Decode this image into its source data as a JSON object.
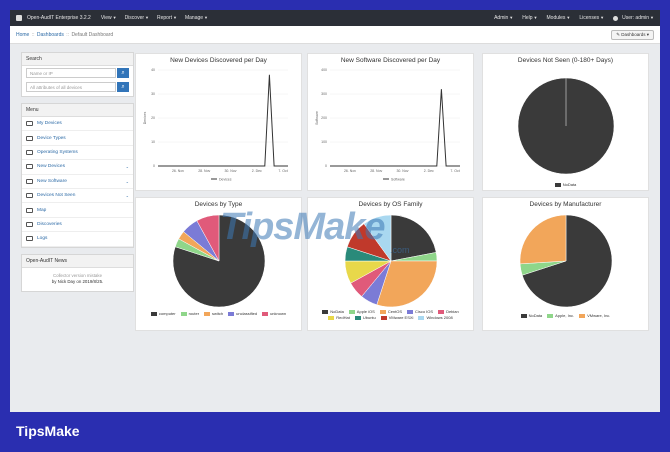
{
  "navbar": {
    "brand": "Open-AudIT Enterprise 3.2.2",
    "left_items": [
      "View",
      "Discover",
      "Report",
      "Manage"
    ],
    "right_items": [
      "Admin",
      "Help",
      "Modules",
      "Licenses"
    ],
    "user": "User: admin"
  },
  "breadcrumb": {
    "home": "Home",
    "dashboards": "Dashboards",
    "current": "Default Dashboard"
  },
  "dashboards_button": "Dashboards",
  "search": {
    "title": "Search",
    "ip_placeholder": "Name or IP",
    "attr_placeholder": "All attributes of all devices"
  },
  "menu": {
    "title": "Menu",
    "items": [
      {
        "label": "My Devices",
        "icon": "monitor-icon",
        "chevron": ""
      },
      {
        "label": "Device Types",
        "icon": "laptop-icon",
        "chevron": ""
      },
      {
        "label": "Operating Systems",
        "icon": "tag-icon",
        "chevron": ""
      },
      {
        "label": "New Devices",
        "icon": "monitor-icon",
        "chevron": "⌄"
      },
      {
        "label": "New Software",
        "icon": "chart-icon",
        "chevron": "⌄"
      },
      {
        "label": "Devices Not Seen",
        "icon": "server-icon",
        "chevron": "⌄"
      },
      {
        "label": "Map",
        "icon": "map-icon",
        "chevron": ""
      },
      {
        "label": "Discoveries",
        "icon": "globe-icon",
        "chevron": ""
      },
      {
        "label": "Logs",
        "icon": "list-icon",
        "chevron": ""
      }
    ]
  },
  "news": {
    "title": "Open-AudIT News",
    "line1": "Collector version mistake",
    "line2": "by Nick Day on 2019/8/25."
  },
  "watermark": {
    "text": "TipsMake",
    "sub": ".com"
  },
  "footer_brand": "TipsMake",
  "chart_data": [
    {
      "type": "line",
      "title": "New Devices Discovered per Day",
      "ylabel": "Devices",
      "yticks": [
        0,
        10,
        20,
        30,
        40
      ],
      "xticks": [
        "26. Nov",
        "28. Nov",
        "30. Nov",
        "2. Dec",
        "7. Oct"
      ],
      "values": [
        0,
        0,
        0,
        0,
        0,
        0,
        0,
        0,
        0,
        0,
        0,
        0,
        0,
        0,
        0,
        0,
        0,
        0,
        0,
        0,
        0,
        0,
        0,
        0,
        38,
        0,
        0,
        0,
        0
      ],
      "ylim": [
        0,
        40
      ],
      "legend": [
        "Devices"
      ],
      "color": "#333333"
    },
    {
      "type": "line",
      "title": "New Software Discovered per Day",
      "ylabel": "Software",
      "yticks": [
        0,
        100,
        200,
        300,
        400
      ],
      "xticks": [
        "26. Nov",
        "28. Nov",
        "30. Nov",
        "2. Dec",
        "7. Oct"
      ],
      "values": [
        0,
        0,
        0,
        0,
        0,
        0,
        0,
        0,
        0,
        0,
        0,
        0,
        0,
        0,
        0,
        0,
        0,
        0,
        0,
        0,
        0,
        0,
        0,
        0,
        320,
        0,
        0,
        0,
        0
      ],
      "ylim": [
        0,
        400
      ],
      "legend": [
        "Software"
      ],
      "color": "#333333"
    },
    {
      "type": "pie",
      "title": "Devices Not Seen (0-180+ Days)",
      "slices": [
        {
          "name": "NoData",
          "value": 100,
          "color": "#3a3a3a"
        }
      ]
    },
    {
      "type": "pie",
      "title": "Devices by Type",
      "slices": [
        {
          "name": "computer",
          "value": 80,
          "color": "#3a3a3a"
        },
        {
          "name": "router",
          "value": 3,
          "color": "#8fd68a"
        },
        {
          "name": "switch",
          "value": 3,
          "color": "#f2a65a"
        },
        {
          "name": "unclassified",
          "value": 6,
          "color": "#7b7bd6"
        },
        {
          "name": "unknown",
          "value": 8,
          "color": "#e05a7a"
        }
      ]
    },
    {
      "type": "pie",
      "title": "Devices by OS Family",
      "slices": [
        {
          "name": "NoData",
          "value": 22,
          "color": "#3a3a3a"
        },
        {
          "name": "Apple iOS",
          "value": 3,
          "color": "#8fd68a"
        },
        {
          "name": "CentOS",
          "value": 30,
          "color": "#f2a65a"
        },
        {
          "name": "Cisco IOS",
          "value": 6,
          "color": "#7b7bd6"
        },
        {
          "name": "Debian",
          "value": 6,
          "color": "#e05a7a"
        },
        {
          "name": "RedHat",
          "value": 8,
          "color": "#e8d84a"
        },
        {
          "name": "Ubuntu",
          "value": 5,
          "color": "#2a8a7a"
        },
        {
          "name": "VMware ESXi",
          "value": 10,
          "color": "#c0392b"
        },
        {
          "name": "Windows 2008",
          "value": 10,
          "color": "#a9d8f0"
        }
      ]
    },
    {
      "type": "pie",
      "title": "Devices by Manufacturer",
      "slices": [
        {
          "name": "NoData",
          "value": 70,
          "color": "#3a3a3a"
        },
        {
          "name": "Apple, Inc.",
          "value": 4,
          "color": "#8fd68a"
        },
        {
          "name": "VMware, Inc.",
          "value": 26,
          "color": "#f2a65a"
        }
      ]
    }
  ]
}
